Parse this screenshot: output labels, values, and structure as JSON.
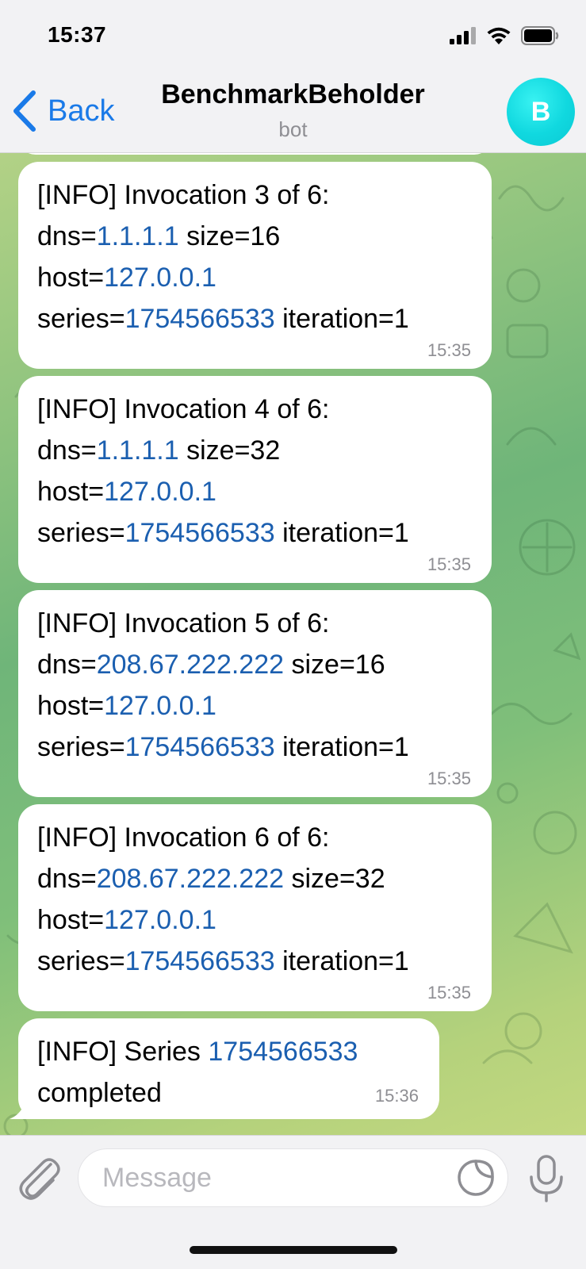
{
  "status_bar": {
    "time": "15:37"
  },
  "header": {
    "back_label": "Back",
    "title": "BenchmarkBeholder",
    "subtitle": "bot",
    "avatar_letter": "B"
  },
  "messages": [
    {
      "line1": "[INFO] Invocation 3 of 6:",
      "dns_prefix": "dns=",
      "dns": "1.1.1.1",
      "size": " size=16",
      "host_prefix": "host=",
      "host": "127.0.0.1",
      "series_prefix": "series=",
      "series": "1754566533",
      "iteration": " iteration=1",
      "time": "15:35"
    },
    {
      "line1": "[INFO] Invocation 4 of 6:",
      "dns_prefix": "dns=",
      "dns": "1.1.1.1",
      "size": " size=32",
      "host_prefix": "host=",
      "host": "127.0.0.1",
      "series_prefix": "series=",
      "series": "1754566533",
      "iteration": " iteration=1",
      "time": "15:35"
    },
    {
      "line1": "[INFO] Invocation 5 of 6:",
      "dns_prefix": "dns=",
      "dns": "208.67.222.222",
      "size": " size=16",
      "host_prefix": "host=",
      "host": "127.0.0.1",
      "series_prefix": "series=",
      "series": "1754566533",
      "iteration": " iteration=1",
      "time": "15:35"
    },
    {
      "line1": "[INFO] Invocation 6 of 6:",
      "dns_prefix": "dns=",
      "dns": "208.67.222.222",
      "size": " size=32",
      "host_prefix": "host=",
      "host": "127.0.0.1",
      "series_prefix": "series=",
      "series": "1754566533",
      "iteration": " iteration=1",
      "time": "15:35"
    }
  ],
  "last_message": {
    "prefix": "[INFO] Series ",
    "series": "1754566533",
    "line2": "completed",
    "time": "15:36"
  },
  "input": {
    "placeholder": "Message"
  },
  "colors": {
    "accent": "#1a7ae8",
    "link": "#1b5fb0",
    "avatar": "#10d8df"
  },
  "icons": [
    "signal-icon",
    "wifi-icon",
    "battery-icon",
    "chevron-left-icon",
    "paperclip-icon",
    "sticker-icon",
    "microphone-icon"
  ]
}
